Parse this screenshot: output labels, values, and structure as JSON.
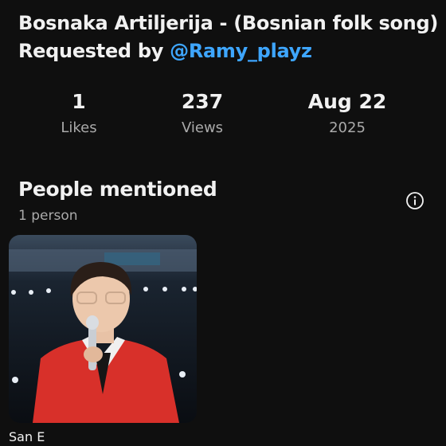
{
  "header": {
    "title_line1": "Bosnaka Artiljerija - (Bosnian folk song)",
    "title_prefix": "Requested by ",
    "mention": "@Ramy_playz"
  },
  "stats": [
    {
      "value": "1",
      "label": "Likes"
    },
    {
      "value": "237",
      "label": "Views"
    },
    {
      "value": "Aug 22",
      "label": "2025"
    }
  ],
  "people_section": {
    "title": "People mentioned",
    "count": "1 person",
    "info_icon": "info-icon"
  },
  "people": [
    {
      "name": "San E",
      "thumbnail": "person-photo"
    }
  ],
  "colors": {
    "background": "#0f0f0f",
    "text": "#f1f1f1",
    "secondary_text": "#aaaaaa",
    "link": "#3ea6ff",
    "jacket": "#d8302a"
  }
}
